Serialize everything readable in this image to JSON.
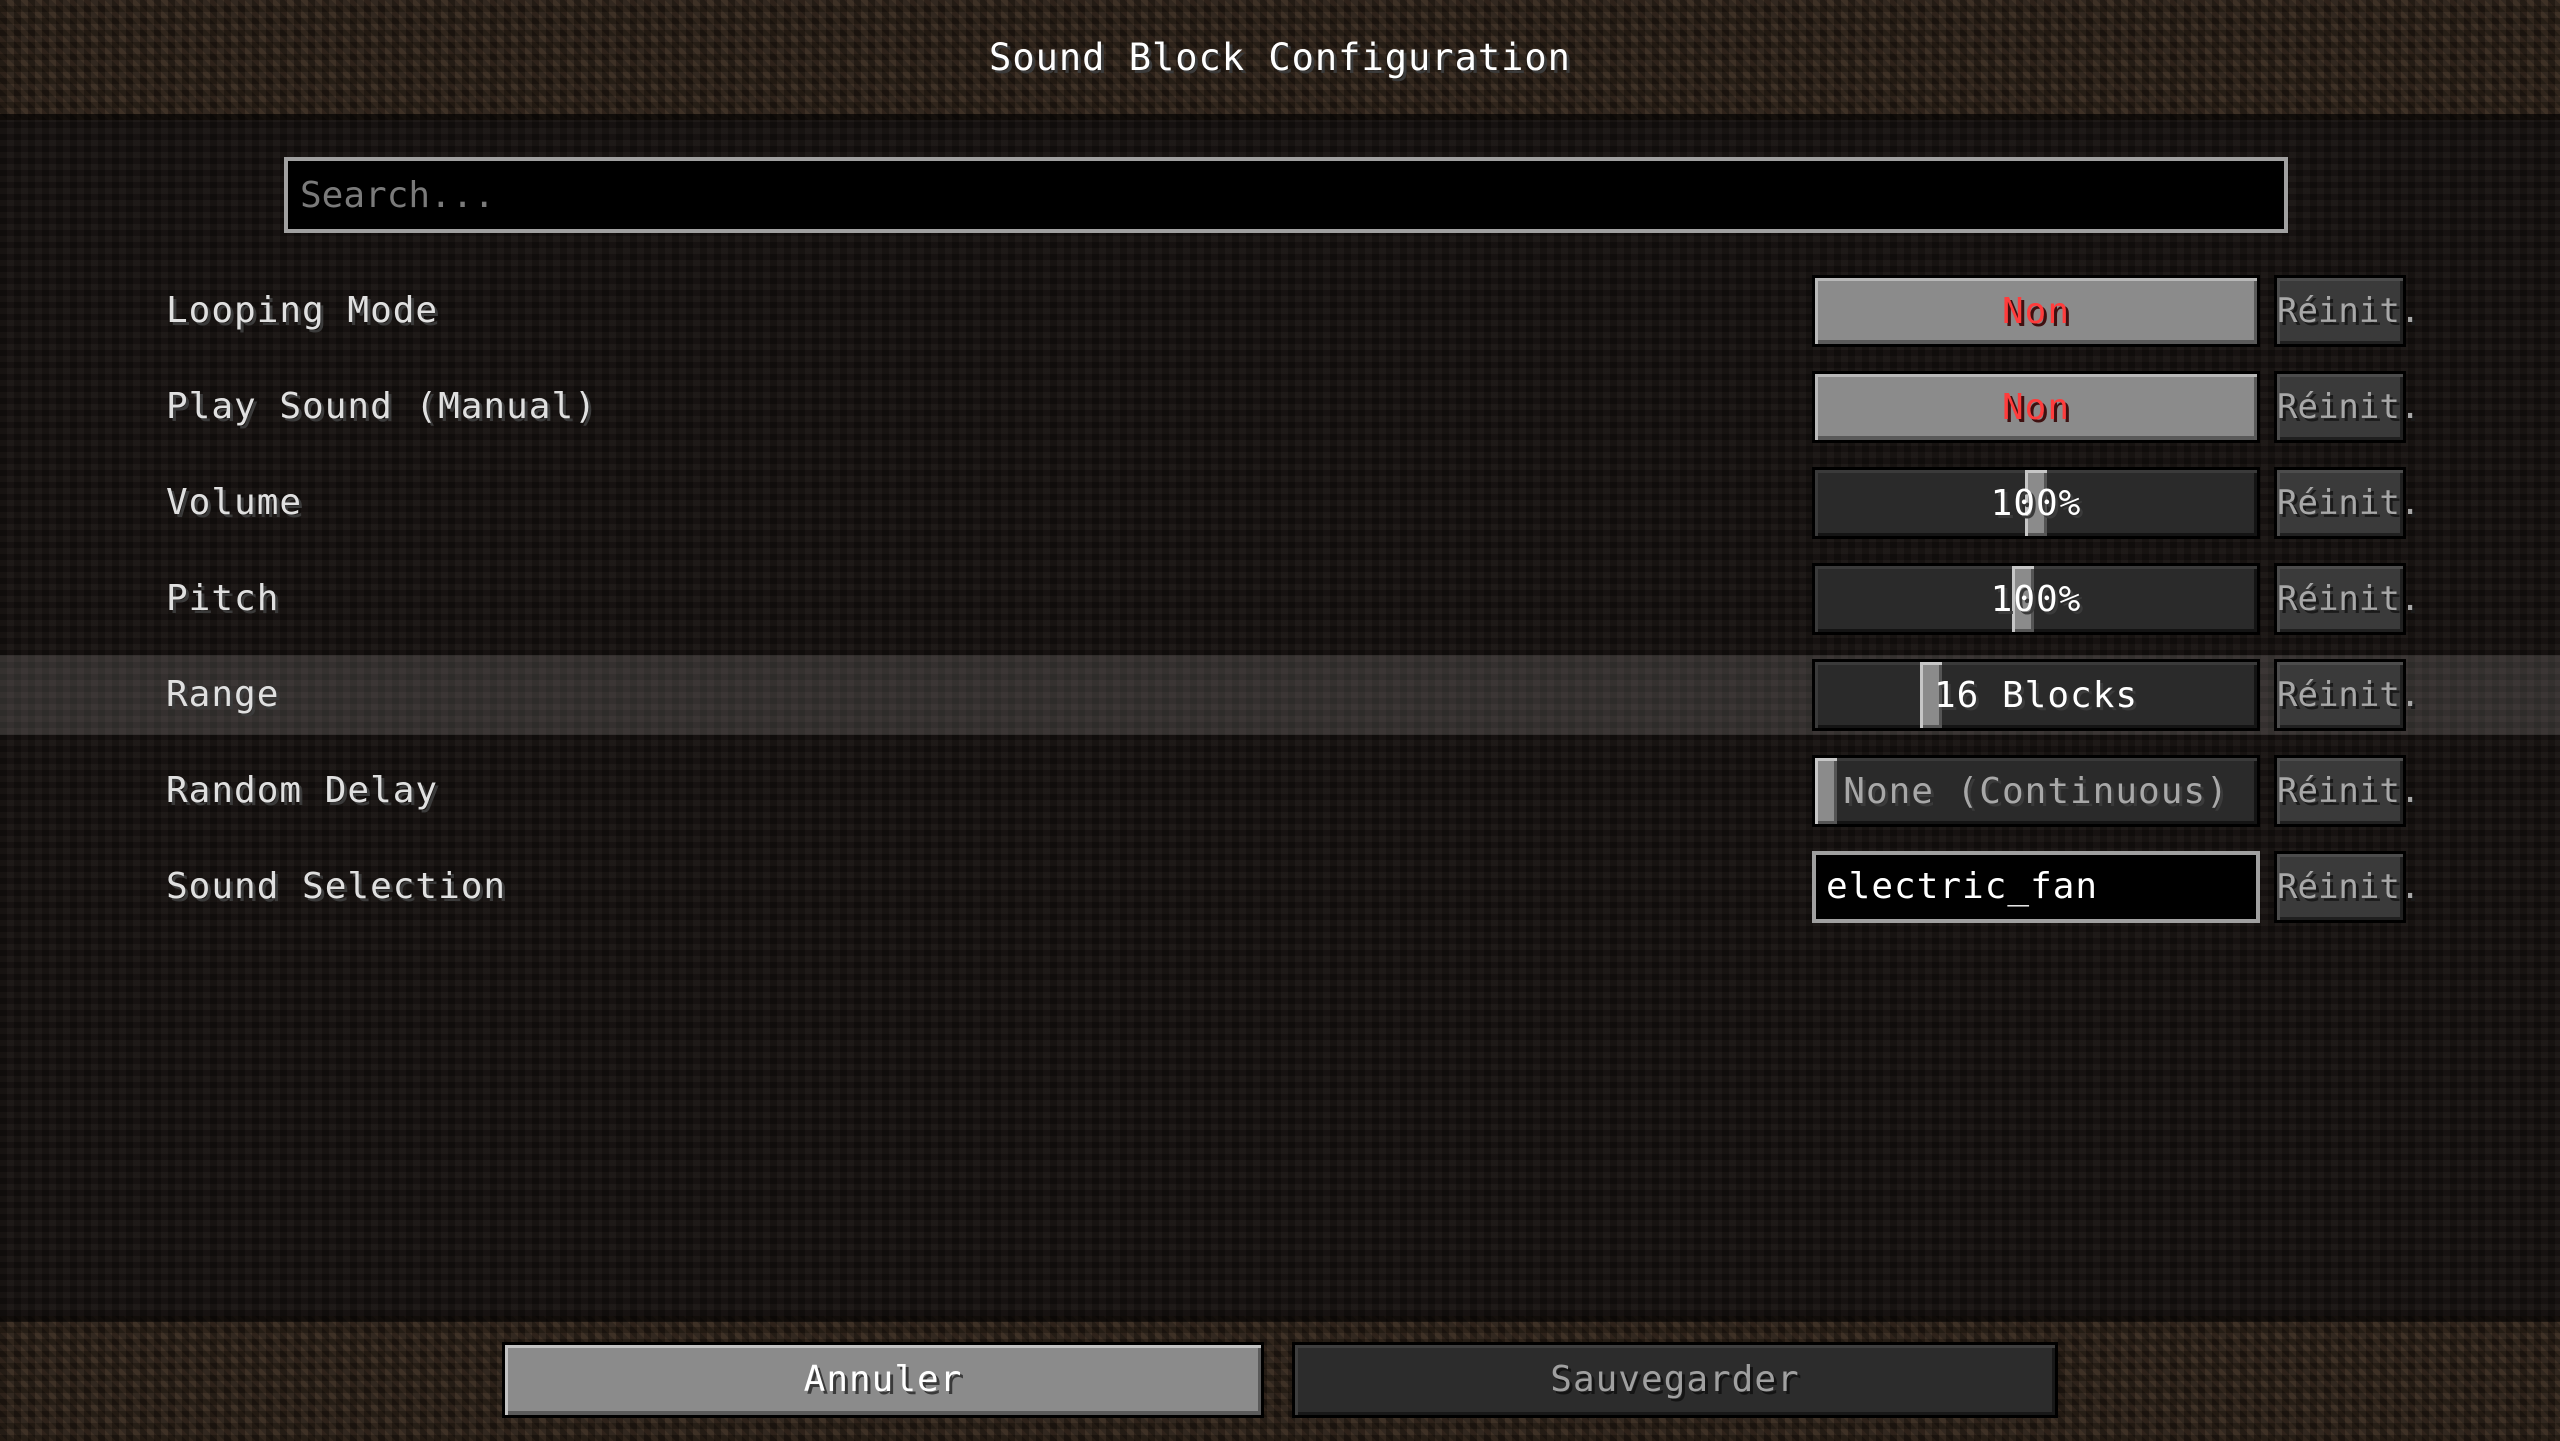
{
  "window": {
    "title": "Sound Block Configuration"
  },
  "search": {
    "placeholder": "Search..."
  },
  "settings": [
    {
      "label": "Looping Mode",
      "control": "toggle",
      "value": "Non",
      "value_color": "#ff3c3c",
      "reset_label": "Réinit."
    },
    {
      "label": "Play Sound (Manual)",
      "control": "toggle",
      "value": "Non",
      "value_color": "#ff3c3c",
      "reset_label": "Réinit."
    },
    {
      "label": "Volume",
      "control": "slider",
      "value": "100%",
      "level": 0.5,
      "reset_label": "Réinit."
    },
    {
      "label": "Pitch",
      "control": "slider",
      "value": "100%",
      "level": 0.47,
      "reset_label": "Réinit."
    },
    {
      "label": "Range",
      "control": "slider",
      "value": "16 Blocks",
      "level": 0.25,
      "highlighted": true,
      "reset_label": "Réinit."
    },
    {
      "label": "Random Delay",
      "control": "slider",
      "value": "None (Continuous)",
      "level": 0.0,
      "dimmed": true,
      "reset_label": "Réinit."
    },
    {
      "label": "Sound Selection",
      "control": "text",
      "value": "electric_fan",
      "reset_label": "Réinit."
    }
  ],
  "footer": {
    "cancel_label": "Annuler",
    "save_label": "Sauvegarder"
  }
}
